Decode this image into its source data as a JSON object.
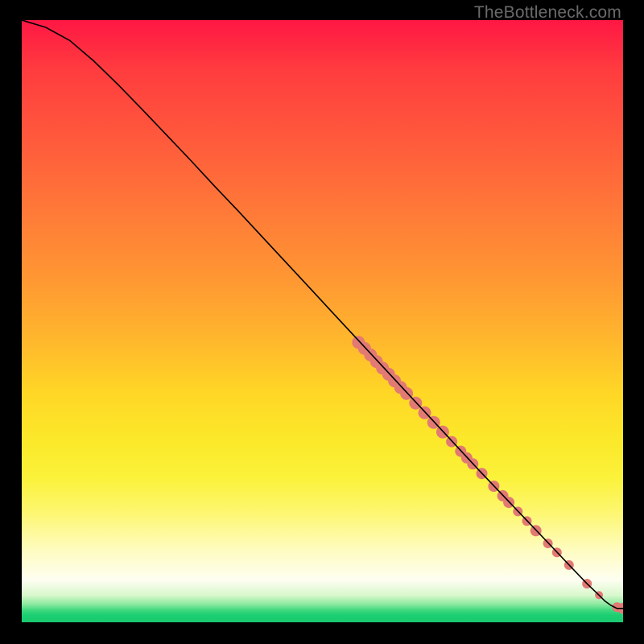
{
  "watermark": "TheBottleneck.com",
  "chart_data": {
    "type": "line",
    "title": "",
    "xlabel": "",
    "ylabel": "",
    "xlim": [
      0,
      100
    ],
    "ylim": [
      0,
      100
    ],
    "series": [
      {
        "name": "curve",
        "x": [
          0,
          4,
          8,
          12,
          16,
          20,
          24,
          28,
          32,
          36,
          40,
          44,
          48,
          52,
          56,
          60,
          64,
          68,
          72,
          76,
          80,
          84,
          88,
          92,
          94,
          96,
          97,
          98,
          99,
          100
        ],
        "y": [
          100,
          98.8,
          96.6,
          93.2,
          89.3,
          85.2,
          81.0,
          76.8,
          72.5,
          68.3,
          64.0,
          59.7,
          55.4,
          51.1,
          46.8,
          42.5,
          38.2,
          33.9,
          29.6,
          25.3,
          21.1,
          16.9,
          12.7,
          8.5,
          6.4,
          4.5,
          3.5,
          2.8,
          2.3,
          2.3
        ]
      }
    ],
    "markers": [
      {
        "x": 56.0,
        "y": 46.5,
        "r": 8
      },
      {
        "x": 57.0,
        "y": 45.5,
        "r": 8
      },
      {
        "x": 58.0,
        "y": 44.4,
        "r": 8
      },
      {
        "x": 59.0,
        "y": 43.3,
        "r": 8
      },
      {
        "x": 60.0,
        "y": 42.2,
        "r": 8
      },
      {
        "x": 61.0,
        "y": 41.2,
        "r": 8
      },
      {
        "x": 62.0,
        "y": 40.1,
        "r": 8
      },
      {
        "x": 63.0,
        "y": 39.0,
        "r": 8
      },
      {
        "x": 64.0,
        "y": 38.0,
        "r": 8
      },
      {
        "x": 65.5,
        "y": 36.4,
        "r": 8
      },
      {
        "x": 67.0,
        "y": 34.8,
        "r": 8
      },
      {
        "x": 68.5,
        "y": 33.2,
        "r": 8
      },
      {
        "x": 70.0,
        "y": 31.6,
        "r": 8
      },
      {
        "x": 71.5,
        "y": 30.0,
        "r": 7
      },
      {
        "x": 73.0,
        "y": 28.4,
        "r": 7
      },
      {
        "x": 74.0,
        "y": 27.3,
        "r": 7
      },
      {
        "x": 75.0,
        "y": 26.3,
        "r": 7
      },
      {
        "x": 76.5,
        "y": 24.7,
        "r": 7
      },
      {
        "x": 78.5,
        "y": 22.6,
        "r": 7
      },
      {
        "x": 80.0,
        "y": 21.0,
        "r": 7
      },
      {
        "x": 81.0,
        "y": 19.9,
        "r": 7
      },
      {
        "x": 82.5,
        "y": 18.4,
        "r": 6
      },
      {
        "x": 84.0,
        "y": 16.8,
        "r": 6
      },
      {
        "x": 85.5,
        "y": 15.2,
        "r": 7
      },
      {
        "x": 87.5,
        "y": 13.1,
        "r": 6
      },
      {
        "x": 89.0,
        "y": 11.6,
        "r": 6
      },
      {
        "x": 91.0,
        "y": 9.5,
        "r": 6
      },
      {
        "x": 94.0,
        "y": 6.4,
        "r": 6
      },
      {
        "x": 96.0,
        "y": 4.5,
        "r": 5
      },
      {
        "x": 99.0,
        "y": 2.5,
        "r": 6
      },
      {
        "x": 100.0,
        "y": 2.3,
        "r": 7
      }
    ],
    "marker_color": "#e27a73",
    "line_color": "#000000"
  }
}
